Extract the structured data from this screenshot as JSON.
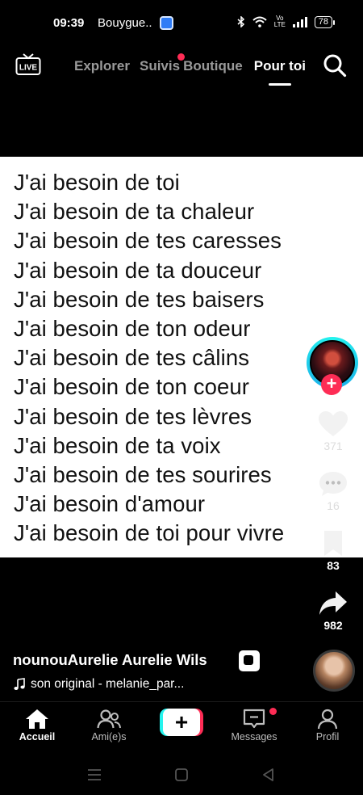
{
  "status_bar": {
    "time": "09:39",
    "carrier": "Bouygue..",
    "network": "Vo LTE",
    "battery": "78"
  },
  "top_nav": {
    "live_label": "LIVE",
    "tabs": [
      {
        "label": "Explorer",
        "active": false
      },
      {
        "label": "Suivis",
        "active": false,
        "notification_dot": true
      },
      {
        "label": "Boutique",
        "active": false
      },
      {
        "label": "Pour toi",
        "active": true
      }
    ]
  },
  "video": {
    "lines": [
      "J'ai besoin de toi",
      "J'ai besoin de ta chaleur",
      "J'ai besoin de tes caresses",
      "J'ai besoin de ta douceur",
      "J'ai besoin de tes baisers",
      "J'ai besoin de ton odeur",
      "J'ai besoin de tes câlins",
      "J'ai besoin de ton coeur",
      "J'ai besoin de tes lèvres",
      "J'ai besoin de ta voix",
      "J'ai besoin de tes sourires",
      "J'ai besoin d'amour",
      "J'ai besoin de toi pour vivre"
    ]
  },
  "right_rail": {
    "follow_symbol": "+",
    "likes": "371",
    "comments": "16",
    "bookmarks": "83",
    "shares": "982"
  },
  "caption": {
    "username": "nounouAurelie Aurelie Wils",
    "sound": "son original - melanie_par..."
  },
  "bottom_nav": {
    "items": [
      {
        "label": "Accueil",
        "icon": "home-icon",
        "active": true
      },
      {
        "label": "Ami(e)s",
        "icon": "friends-icon",
        "active": false
      },
      {
        "label": "+",
        "icon": "create-icon",
        "active": false
      },
      {
        "label": "Messages",
        "icon": "inbox-icon",
        "active": false,
        "notification_dot": true
      },
      {
        "label": "Profil",
        "icon": "profile-icon",
        "active": false
      }
    ]
  },
  "colors": {
    "accent_red": "#fe2c55",
    "accent_cyan": "#25f4ee",
    "background": "#000000",
    "video_background": "#ffffff"
  }
}
